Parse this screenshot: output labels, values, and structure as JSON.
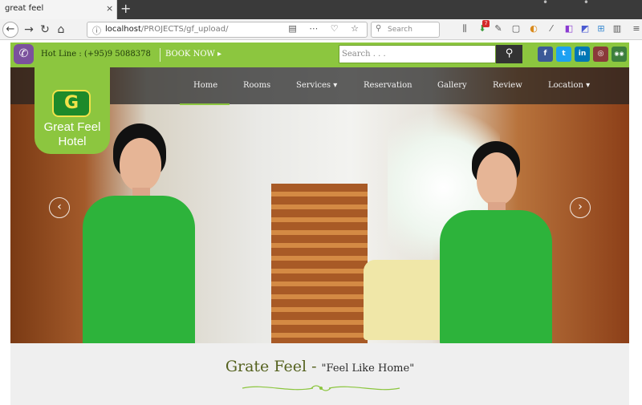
{
  "browser": {
    "tab_title": "great feel",
    "tab_close": "×",
    "new_tab": "+",
    "url_host": "localhost",
    "url_path": "/PROJECTS/gf_upload/",
    "search_placeholder": "Search",
    "extension_badge": "7"
  },
  "topbar": {
    "hotline": "Hot Line : (+95)9 5088378",
    "book_now": "BOOK NOW",
    "search_placeholder": "Search . . ."
  },
  "social": [
    {
      "name": "facebook",
      "glyph": "f",
      "color": "#3b5998"
    },
    {
      "name": "twitter",
      "glyph": "t",
      "color": "#1da1f2"
    },
    {
      "name": "linkedin",
      "glyph": "in",
      "color": "#0077b5"
    },
    {
      "name": "instagram",
      "glyph": "◎",
      "color": "#8a3a3a"
    },
    {
      "name": "tripadvisor",
      "glyph": "◉◉",
      "color": "#3d7f3d"
    }
  ],
  "menu": {
    "items": [
      "Home",
      "Rooms",
      "Services ▾",
      "Reservation",
      "Gallery",
      "Review",
      "Location ▾"
    ],
    "active": "Home"
  },
  "logo": {
    "line1": "Great Feel",
    "line2": "Hotel"
  },
  "welcome": {
    "brand": "Grate Feel",
    "separator": " - ",
    "tagline": "\"Feel Like Home\""
  },
  "colors": {
    "brand_green": "#8cc63f",
    "nav_overlay": "#232323",
    "uniform_green": "#2db33b"
  }
}
